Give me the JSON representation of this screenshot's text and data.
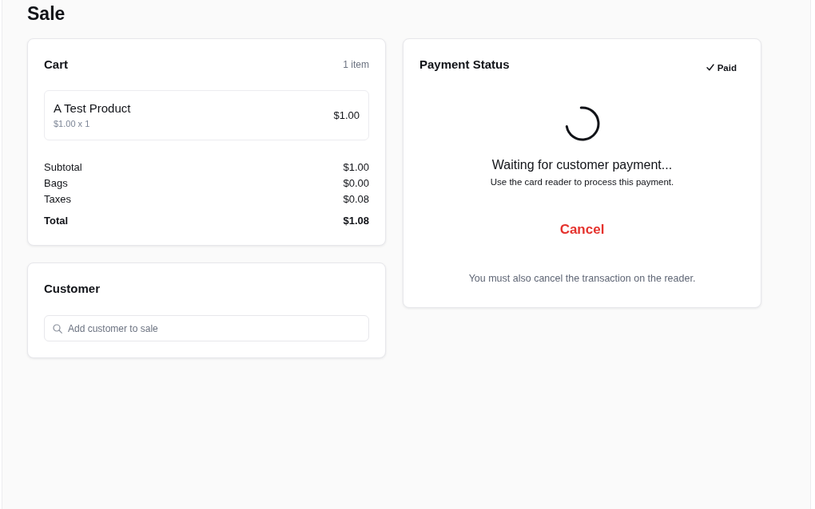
{
  "page": {
    "title": "Sale"
  },
  "cart": {
    "title": "Cart",
    "count": "1 item",
    "items": [
      {
        "name": "A Test Product",
        "detail": "$1.00 x 1",
        "price": "$1.00"
      }
    ],
    "totals": [
      {
        "kind": "line",
        "label": "Subtotal",
        "value": "$1.00"
      },
      {
        "kind": "line",
        "label": "Bags",
        "value": "$0.00"
      },
      {
        "kind": "line",
        "label": "Taxes",
        "value": "$0.08"
      },
      {
        "kind": "total",
        "label": "Total",
        "value": "$1.08"
      }
    ]
  },
  "customer": {
    "title": "Customer",
    "search": {
      "placeholder": "Add customer to sale"
    }
  },
  "payment": {
    "title": "Payment Status",
    "status": "Paid",
    "message": "Waiting for customer payment...",
    "hint": "Use the card reader to process this payment.",
    "cancel_button": "Cancel",
    "note": "You must also cancel the transaction on the reader."
  }
}
